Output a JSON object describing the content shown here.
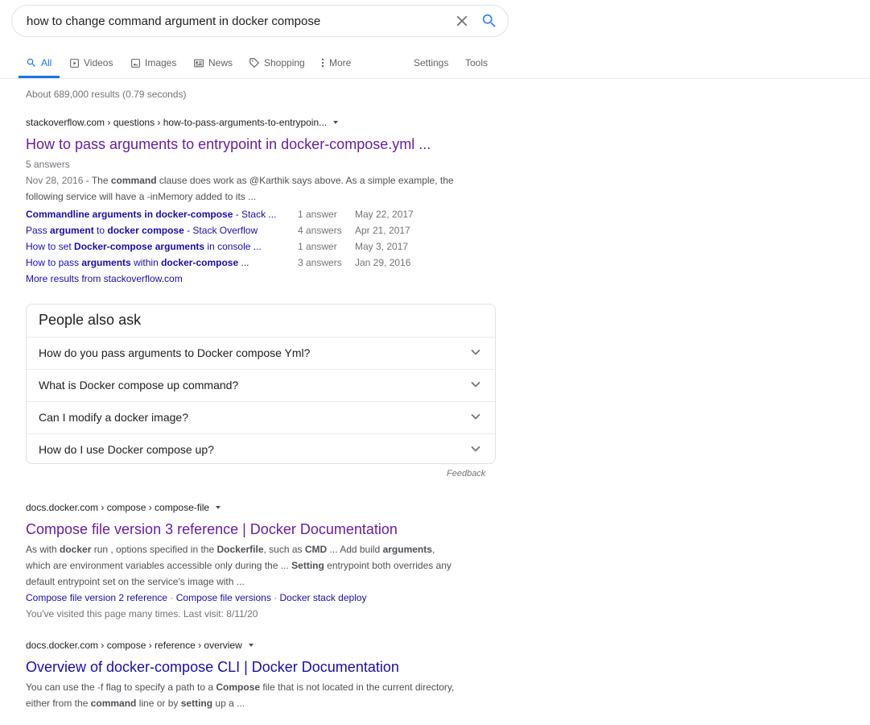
{
  "search": {
    "query": "how to change command argument in docker compose"
  },
  "tabs": [
    {
      "label": "All",
      "icon": "search-icon"
    },
    {
      "label": "Videos",
      "icon": "video-icon"
    },
    {
      "label": "Images",
      "icon": "image-icon"
    },
    {
      "label": "News",
      "icon": "news-icon"
    },
    {
      "label": "Shopping",
      "icon": "tag-icon"
    },
    {
      "label": "More",
      "icon": "more-vert-icon"
    }
  ],
  "tools": {
    "settings": "Settings",
    "tools": "Tools"
  },
  "stats": "About 689,000 results (0.79 seconds)",
  "results": [
    {
      "cite": "stackoverflow.com › questions › how-to-pass-arguments-to-entrypoin...",
      "title": "How to pass arguments to entrypoint in docker-compose.yml ...",
      "meta": "5 answers",
      "date": "Nov 28, 2016",
      "snippet_parts": [
        " - The ",
        "command",
        " clause does work as @Karthik says above. As a simple example, the following service will have a -inMemory added to its ..."
      ],
      "sublinks": [
        {
          "parts": [
            "Commandline arguments in docker-compose",
            " - Stack ..."
          ],
          "answers": "1 answer",
          "date": "May 22, 2017"
        },
        {
          "parts": [
            "Pass ",
            "argument",
            " to ",
            "docker compose",
            " - Stack Overflow"
          ],
          "answers": "4 answers",
          "date": "Apr 21, 2017"
        },
        {
          "parts": [
            "How to set ",
            "Docker-compose arguments",
            " in console ..."
          ],
          "answers": "1 answer",
          "date": "May 3, 2017"
        },
        {
          "parts": [
            "How to pass ",
            "arguments",
            " within ",
            "docker-compose",
            " ..."
          ],
          "answers": "3 answers",
          "date": "Jan 29, 2016"
        }
      ],
      "more": "More results from stackoverflow.com"
    },
    {
      "cite": "docs.docker.com › compose › compose-file",
      "title": "Compose file version 3 reference | Docker Documentation",
      "snippet_parts": [
        "As with ",
        "docker",
        " run , options specified in the ",
        "Dockerfile",
        ", such as ",
        "CMD",
        " ... Add build ",
        "arguments",
        ", which are environment variables accessible only during the ... ",
        "Setting",
        " entrypoint both overrides any default entrypoint set on the service's image with ..."
      ],
      "sitelinks": [
        "Compose file version 2 reference",
        "Compose file versions",
        "Docker stack deploy"
      ],
      "visited_note": "You've visited this page many times. Last visit: 8/11/20"
    },
    {
      "cite": "docs.docker.com › compose › reference › overview",
      "title": "Overview of docker-compose CLI | Docker Documentation",
      "snippet_parts": [
        "You can use the -f flag to specify a path to a ",
        "Compose",
        " file that is not located in the current directory, either from the ",
        "command",
        " line or by ",
        "setting",
        " up a ..."
      ]
    }
  ],
  "paa": {
    "title": "People also ask",
    "questions": [
      "How do you pass arguments to Docker compose Yml?",
      "What is Docker compose up command?",
      "Can I modify a docker image?",
      "How do I use Docker compose up?"
    ],
    "feedback": "Feedback"
  }
}
